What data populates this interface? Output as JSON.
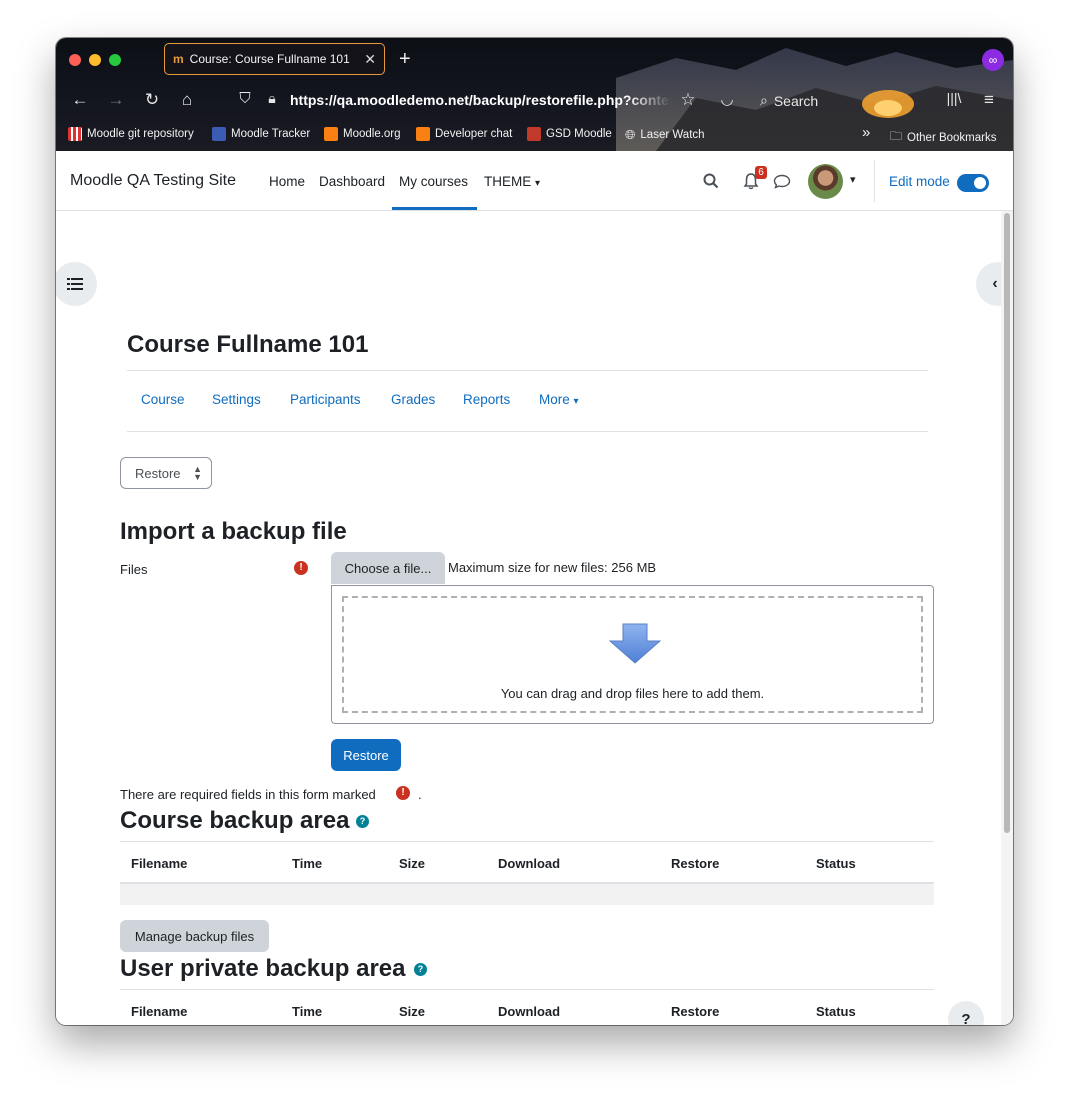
{
  "browser": {
    "tab_title": "Course: Course Fullname 101",
    "url": "https://qa.moodledemo.net/backup/restorefile.php?contextid=",
    "search_label": "Search",
    "bookmarks": [
      {
        "label": "Moodle git repository"
      },
      {
        "label": "Moodle Tracker"
      },
      {
        "label": "Moodle.org"
      },
      {
        "label": "Developer chat"
      },
      {
        "label": "GSD Moodle"
      },
      {
        "label": "Laser Watch"
      },
      {
        "label": "Other Bookmarks"
      }
    ],
    "overflow_glyph": "»"
  },
  "site": {
    "name": "Moodle QA Testing Site",
    "primary_nav": [
      "Home",
      "Dashboard",
      "My courses",
      "THEME"
    ],
    "active_nav": "My courses",
    "notification_count": "6",
    "edit_mode_label": "Edit mode",
    "edit_mode_on": true
  },
  "course": {
    "title": "Course Fullname 101",
    "secondary_nav": [
      "Course",
      "Settings",
      "Participants",
      "Grades",
      "Reports",
      "More"
    ]
  },
  "restore_select": {
    "value": "Restore"
  },
  "import": {
    "heading": "Import a backup file",
    "files_label": "Files",
    "choose_file_label": "Choose a file...",
    "max_size_text": "Maximum size for new files: 256 MB",
    "drop_text": "You can drag and drop files here to add them.",
    "restore_button": "Restore",
    "required_note": "There are required fields in this form marked",
    "required_note_end": "."
  },
  "course_backup": {
    "heading": "Course backup area",
    "columns": [
      "Filename",
      "Time",
      "Size",
      "Download",
      "Restore",
      "Status"
    ],
    "manage_button": "Manage backup files"
  },
  "user_backup": {
    "heading": "User private backup area",
    "columns": [
      "Filename",
      "Time",
      "Size",
      "Download",
      "Restore",
      "Status"
    ]
  },
  "footer": {
    "help_label": "?"
  },
  "colors": {
    "primary": "#0f6cbf",
    "danger": "#ca3120",
    "info": "#008196",
    "tab_border": "#e79a3c"
  }
}
